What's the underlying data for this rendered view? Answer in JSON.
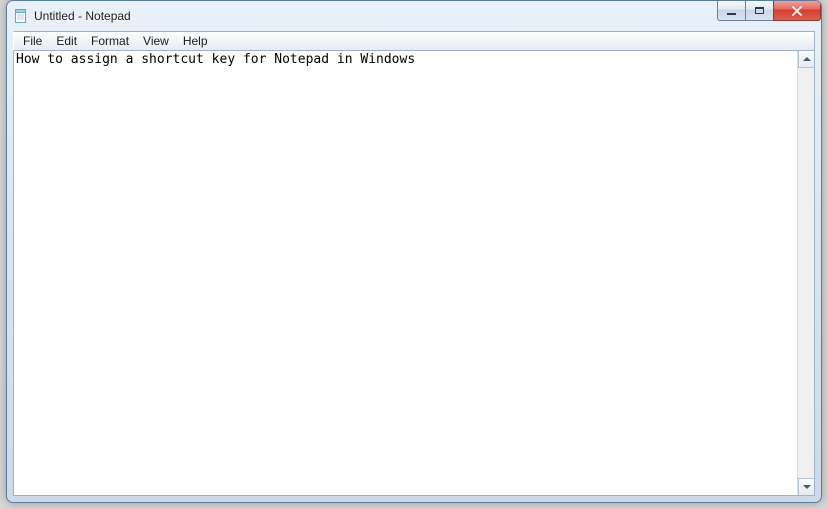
{
  "window": {
    "title": "Untitled - Notepad"
  },
  "menu": {
    "file": "File",
    "edit": "Edit",
    "format": "Format",
    "view": "View",
    "help": "Help"
  },
  "editor": {
    "content": "How to assign a shortcut key for Notepad in Windows"
  }
}
